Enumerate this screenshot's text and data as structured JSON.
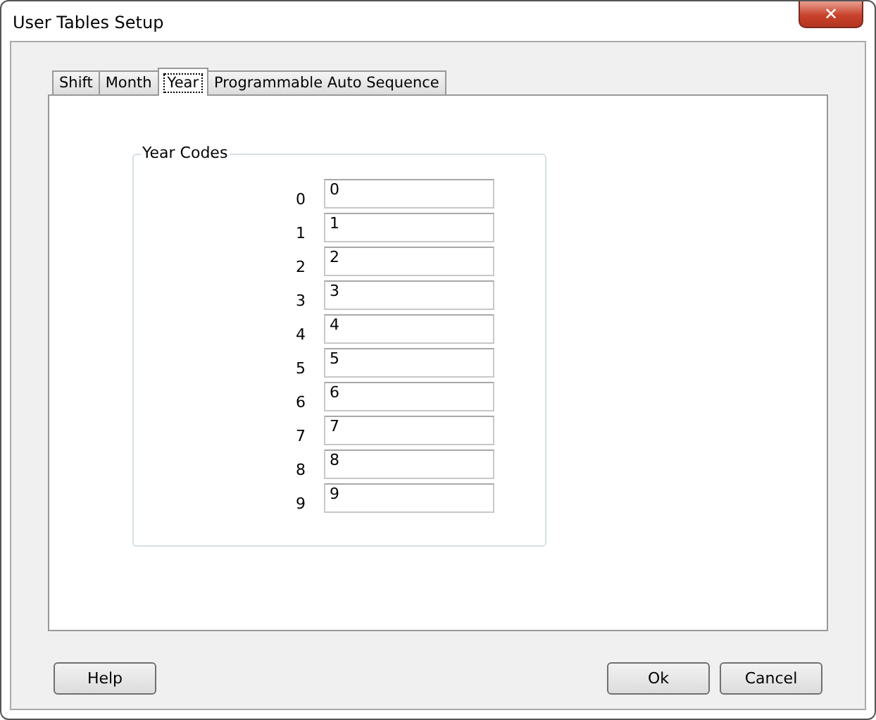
{
  "window": {
    "title": "User Tables Setup",
    "close": "✕"
  },
  "tabs": [
    {
      "label": "Shift",
      "selected": false
    },
    {
      "label": "Month",
      "selected": false
    },
    {
      "label": "Year",
      "selected": true
    },
    {
      "label": "Programmable Auto Sequence",
      "selected": false
    }
  ],
  "group": {
    "title": "Year Codes",
    "rows": [
      {
        "label": "0",
        "value": "0"
      },
      {
        "label": "1",
        "value": "1"
      },
      {
        "label": "2",
        "value": "2"
      },
      {
        "label": "3",
        "value": "3"
      },
      {
        "label": "4",
        "value": "4"
      },
      {
        "label": "5",
        "value": "5"
      },
      {
        "label": "6",
        "value": "6"
      },
      {
        "label": "7",
        "value": "7"
      },
      {
        "label": "8",
        "value": "8"
      },
      {
        "label": "9",
        "value": "9"
      }
    ]
  },
  "buttons_left": [
    {
      "label": "Help"
    }
  ],
  "buttons_right": [
    {
      "label": "Ok"
    },
    {
      "label": "Cancel"
    }
  ]
}
